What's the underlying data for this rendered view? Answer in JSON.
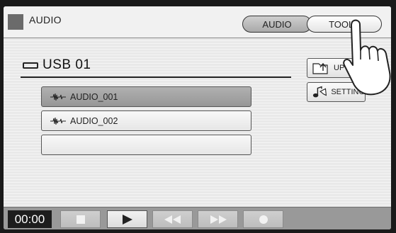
{
  "header": {
    "title": "AUDIO",
    "tabs": [
      {
        "label": "AUDIO",
        "active": false
      },
      {
        "label": "TOOLS",
        "active": true
      }
    ]
  },
  "drive": {
    "label": "USB 01",
    "icon": "usb-drive-icon"
  },
  "files": [
    {
      "name": "AUDIO_001",
      "selected": true,
      "icon": "waveform-icon"
    },
    {
      "name": "AUDIO_002",
      "selected": false,
      "icon": "waveform-icon"
    },
    {
      "name": "",
      "selected": false
    }
  ],
  "side_buttons": [
    {
      "label": "UP",
      "icon": "folder-up-icon"
    },
    {
      "label": "SETTING",
      "icon": "notes-icon"
    }
  ],
  "transport": {
    "time": "00:00",
    "buttons": [
      {
        "name": "stop",
        "icon": "stop-icon",
        "enabled": false
      },
      {
        "name": "play",
        "icon": "play-icon",
        "enabled": true
      },
      {
        "name": "rewind",
        "icon": "rewind-icon",
        "enabled": false
      },
      {
        "name": "fast-forward",
        "icon": "fast-forward-icon",
        "enabled": false
      },
      {
        "name": "record",
        "icon": "record-icon",
        "enabled": false
      }
    ]
  },
  "colors": {
    "screen_bg": "#e9e9e9",
    "selected_row": "#a5a5a5",
    "transport_bar": "#999999",
    "time_display": "#1d1d1d"
  }
}
